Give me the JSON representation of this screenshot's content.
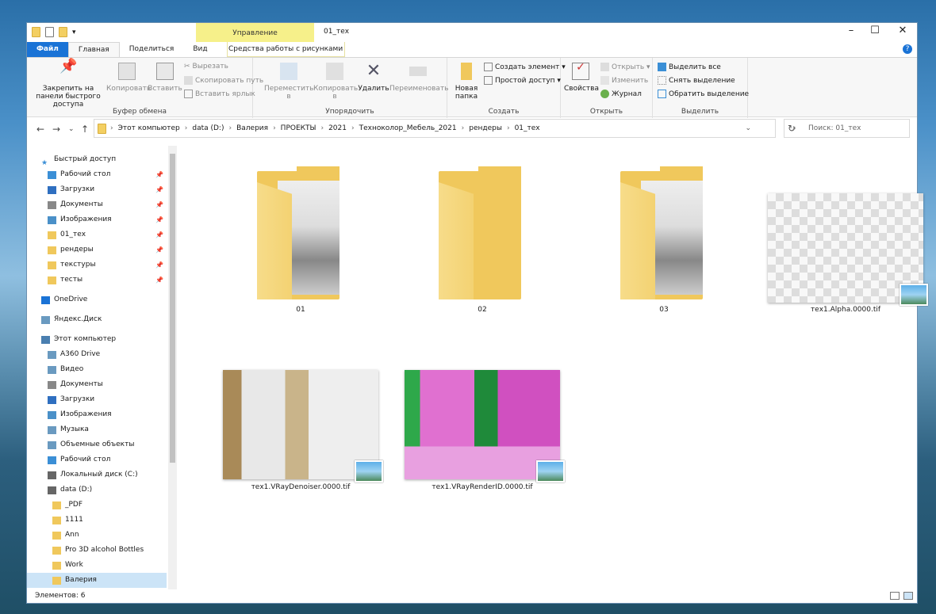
{
  "window": {
    "title": "01_тех",
    "manage_tab": "Управление",
    "minimize": "–",
    "maximize": "☐",
    "close": "✕"
  },
  "tabs": {
    "file": "Файл",
    "home": "Главная",
    "share": "Поделиться",
    "view": "Вид",
    "picture_tools": "Средства работы с рисунками"
  },
  "ribbon": {
    "clipboard": {
      "label": "Буфер обмена",
      "pin": "Закрепить на панели быстрого доступа",
      "copy": "Копировать",
      "paste": "Вставить",
      "cut": "Вырезать",
      "copy_path": "Скопировать путь",
      "paste_shortcut": "Вставить ярлык"
    },
    "organize": {
      "label": "Упорядочить",
      "move_to": "Переместить в",
      "copy_to": "Копировать в",
      "delete": "Удалить",
      "rename": "Переименовать"
    },
    "new": {
      "label": "Создать",
      "new_folder": "Новая папка",
      "new_item": "Создать элемент ▾",
      "easy_access": "Простой доступ ▾"
    },
    "open": {
      "label": "Открыть",
      "properties": "Свойства",
      "open": "Открыть ▾",
      "edit": "Изменить",
      "history": "Журнал"
    },
    "select": {
      "label": "Выделить",
      "select_all": "Выделить все",
      "select_none": "Снять выделение",
      "invert": "Обратить выделение"
    }
  },
  "address": {
    "path": [
      "Этот компьютер",
      "data (D:)",
      "Валерия",
      "ПРОЕКТЫ",
      "2021",
      "Техноколор_Мебель_2021",
      "рендеры",
      "01_тех"
    ],
    "search_placeholder": "Поиск: 01_тех"
  },
  "nav": {
    "items": [
      {
        "label": "Быстрый доступ",
        "icon": "star-icon",
        "level": 0
      },
      {
        "label": "Рабочий стол",
        "icon": "desktop-icon",
        "level": 1,
        "pinned": true
      },
      {
        "label": "Загрузки",
        "icon": "download-icon",
        "level": 1,
        "pinned": true
      },
      {
        "label": "Документы",
        "icon": "documents-icon",
        "level": 1,
        "pinned": true
      },
      {
        "label": "Изображения",
        "icon": "pictures-icon",
        "level": 1,
        "pinned": true
      },
      {
        "label": "01_тех",
        "icon": "folder-icon",
        "level": 1,
        "pinned": true
      },
      {
        "label": "рендеры",
        "icon": "folder-icon",
        "level": 1,
        "pinned": true
      },
      {
        "label": "текстуры",
        "icon": "folder-icon",
        "level": 1,
        "pinned": true
      },
      {
        "label": "тесты",
        "icon": "folder-icon",
        "level": 1,
        "pinned": true
      },
      {
        "label": "OneDrive",
        "icon": "cloud-icon",
        "level": 0,
        "gap": true
      },
      {
        "label": "Яндекс.Диск",
        "icon": "yandex-disk-icon",
        "level": 0,
        "gap": true
      },
      {
        "label": "Этот компьютер",
        "icon": "computer-icon",
        "level": 0,
        "gap": true
      },
      {
        "label": "A360 Drive",
        "icon": "drive-icon",
        "level": 1
      },
      {
        "label": "Видео",
        "icon": "video-icon",
        "level": 1
      },
      {
        "label": "Документы",
        "icon": "documents-icon",
        "level": 1
      },
      {
        "label": "Загрузки",
        "icon": "download-icon",
        "level": 1
      },
      {
        "label": "Изображения",
        "icon": "pictures-icon",
        "level": 1
      },
      {
        "label": "Музыка",
        "icon": "music-icon",
        "level": 1
      },
      {
        "label": "Объемные объекты",
        "icon": "3d-objects-icon",
        "level": 1
      },
      {
        "label": "Рабочий стол",
        "icon": "desktop-icon",
        "level": 1
      },
      {
        "label": "Локальный диск (C:)",
        "icon": "disk-icon",
        "level": 1
      },
      {
        "label": "data (D:)",
        "icon": "disk-icon",
        "level": 1
      },
      {
        "label": "_PDF",
        "icon": "folder-icon",
        "level": 2
      },
      {
        "label": "1111",
        "icon": "folder-icon",
        "level": 2
      },
      {
        "label": "Ann",
        "icon": "folder-icon",
        "level": 2
      },
      {
        "label": "Pro 3D alcohol Bottles",
        "icon": "folder-icon",
        "level": 2
      },
      {
        "label": "Work",
        "icon": "folder-icon",
        "level": 2
      },
      {
        "label": "Валерия",
        "icon": "folder-icon",
        "level": 2,
        "selected": true
      }
    ]
  },
  "files": [
    {
      "name": "01",
      "type": "folder",
      "preview": true
    },
    {
      "name": "02",
      "type": "folder",
      "preview": false
    },
    {
      "name": "03",
      "type": "folder",
      "preview": true
    },
    {
      "name": "тех1.Alpha.0000.tif",
      "type": "image"
    },
    {
      "name": "тех1.VRayDenoiser.0000.tif",
      "type": "image"
    },
    {
      "name": "тех1.VRayRenderID.0000.tif",
      "type": "image"
    }
  ],
  "status": {
    "count": "Элементов: 6"
  },
  "colors": {
    "accent": "#1a73d6",
    "manage": "#f6f08a",
    "folder": "#f0c85c",
    "selected": "#cce4f7"
  }
}
